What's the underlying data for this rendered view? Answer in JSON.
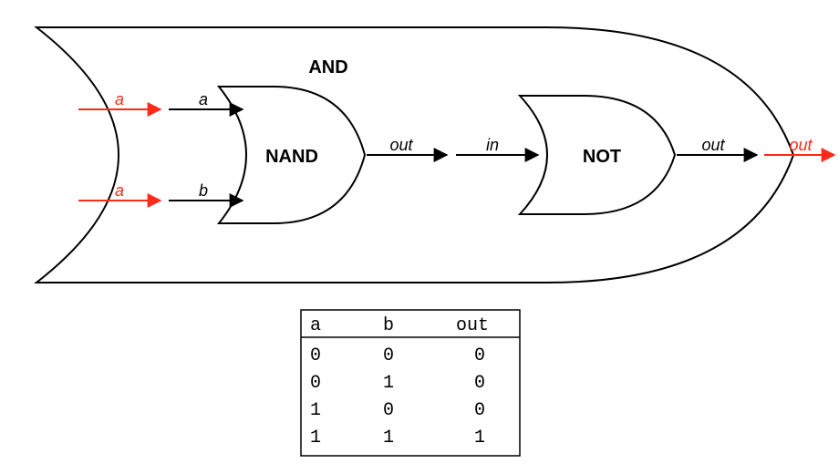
{
  "diagram": {
    "outer_gate": {
      "label": "AND",
      "inputs": [
        "a",
        "a"
      ],
      "output": "out"
    },
    "nand_gate": {
      "label": "NAND",
      "inputs": [
        "a",
        "b"
      ],
      "output": "out"
    },
    "not_gate": {
      "label": "NOT",
      "input": "in",
      "output": "out"
    }
  },
  "chart_data": {
    "type": "table",
    "title": "",
    "columns": [
      "a",
      "b",
      "out"
    ],
    "rows": [
      [
        0,
        0,
        0
      ],
      [
        0,
        1,
        0
      ],
      [
        1,
        0,
        0
      ],
      [
        1,
        1,
        1
      ]
    ]
  },
  "colors": {
    "outer_io": "#ff2a1a",
    "stroke": "#000000"
  }
}
